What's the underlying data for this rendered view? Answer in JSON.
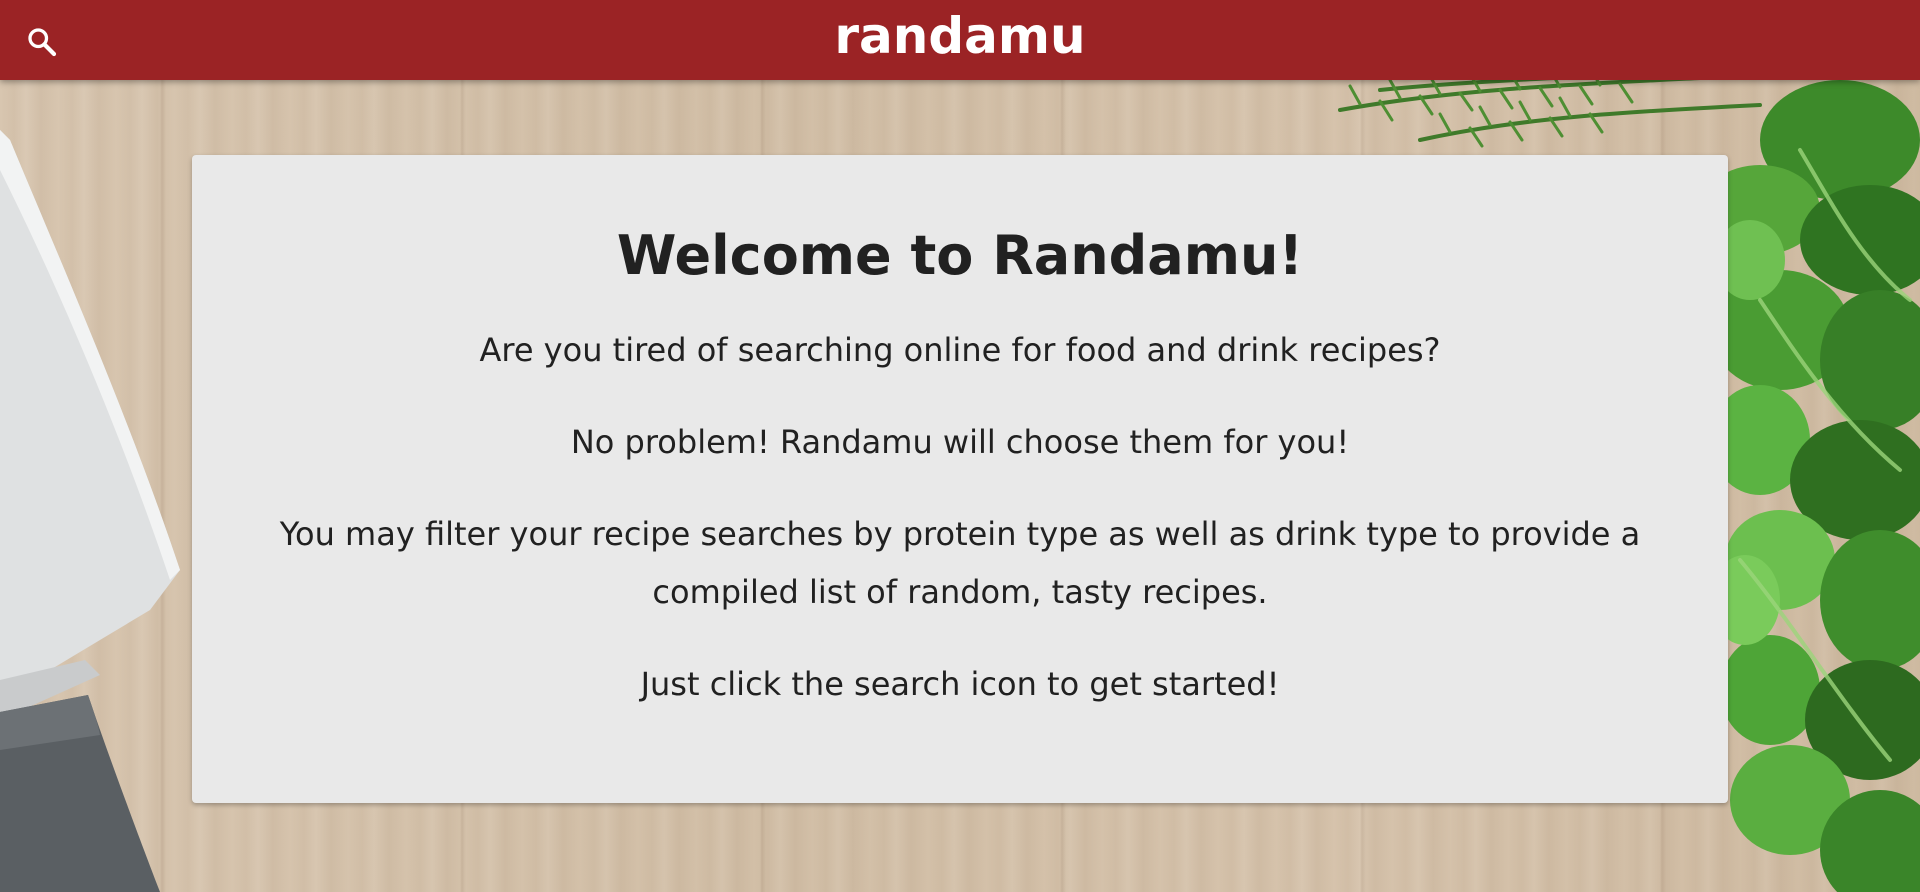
{
  "header": {
    "brand": "randamu",
    "search_icon": "search-icon",
    "background_color": "#9b2325"
  },
  "welcome": {
    "title": "Welcome to Randamu!",
    "paragraphs": [
      "Are you tired of searching online for food and drink recipes?",
      "No problem! Randamu will choose them for you!",
      "You may filter your recipe searches by protein type as well as drink type to provide a compiled list of random, tasty recipes.",
      "Just click the search icon to get started!"
    ]
  },
  "background": {
    "description_icons": [
      "knife-image",
      "herbs-image"
    ],
    "wood_color": "#d6c4ad"
  }
}
